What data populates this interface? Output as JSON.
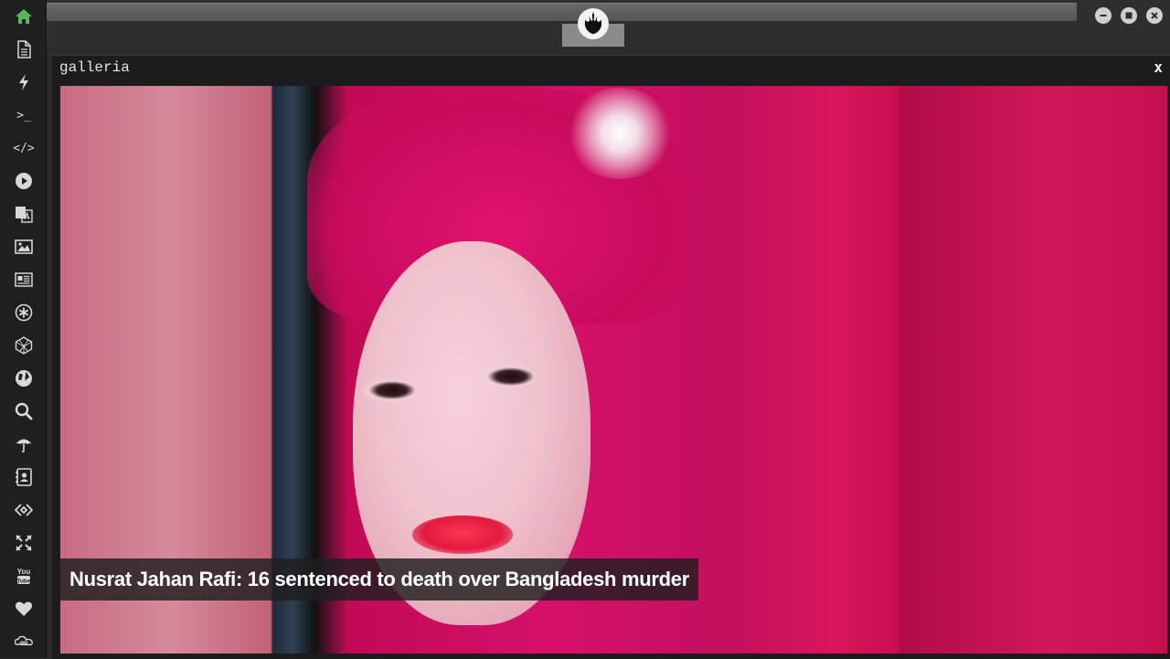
{
  "sidebar": {
    "items": [
      {
        "name": "home-icon",
        "active": true
      },
      {
        "name": "document-icon"
      },
      {
        "name": "lightning-icon"
      },
      {
        "name": "terminal-icon",
        "label": ">_"
      },
      {
        "name": "code-icon",
        "label": "</>"
      },
      {
        "name": "play-icon"
      },
      {
        "name": "translate-icon"
      },
      {
        "name": "image-icon"
      },
      {
        "name": "newspaper-icon"
      },
      {
        "name": "asterisk-icon"
      },
      {
        "name": "cube-icon"
      },
      {
        "name": "globe-icon"
      },
      {
        "name": "search-icon"
      },
      {
        "name": "umbrella-icon"
      },
      {
        "name": "contacts-icon"
      },
      {
        "name": "code-diamond-icon"
      },
      {
        "name": "expand-icon"
      },
      {
        "name": "youtube-icon",
        "label": "You\nTube"
      },
      {
        "name": "heart-icon"
      },
      {
        "name": "infinity-cloud-icon"
      }
    ],
    "accent_color": "#5cb85c"
  },
  "window": {
    "logo": "rebel-alliance-icon",
    "controls": [
      "minimize-icon",
      "maximize-icon",
      "close-icon"
    ]
  },
  "panel": {
    "title": "galleria",
    "close_label": "x",
    "caption": "Nusrat Jahan Rafi: 16 sentenced to death over Bangladesh murder"
  }
}
